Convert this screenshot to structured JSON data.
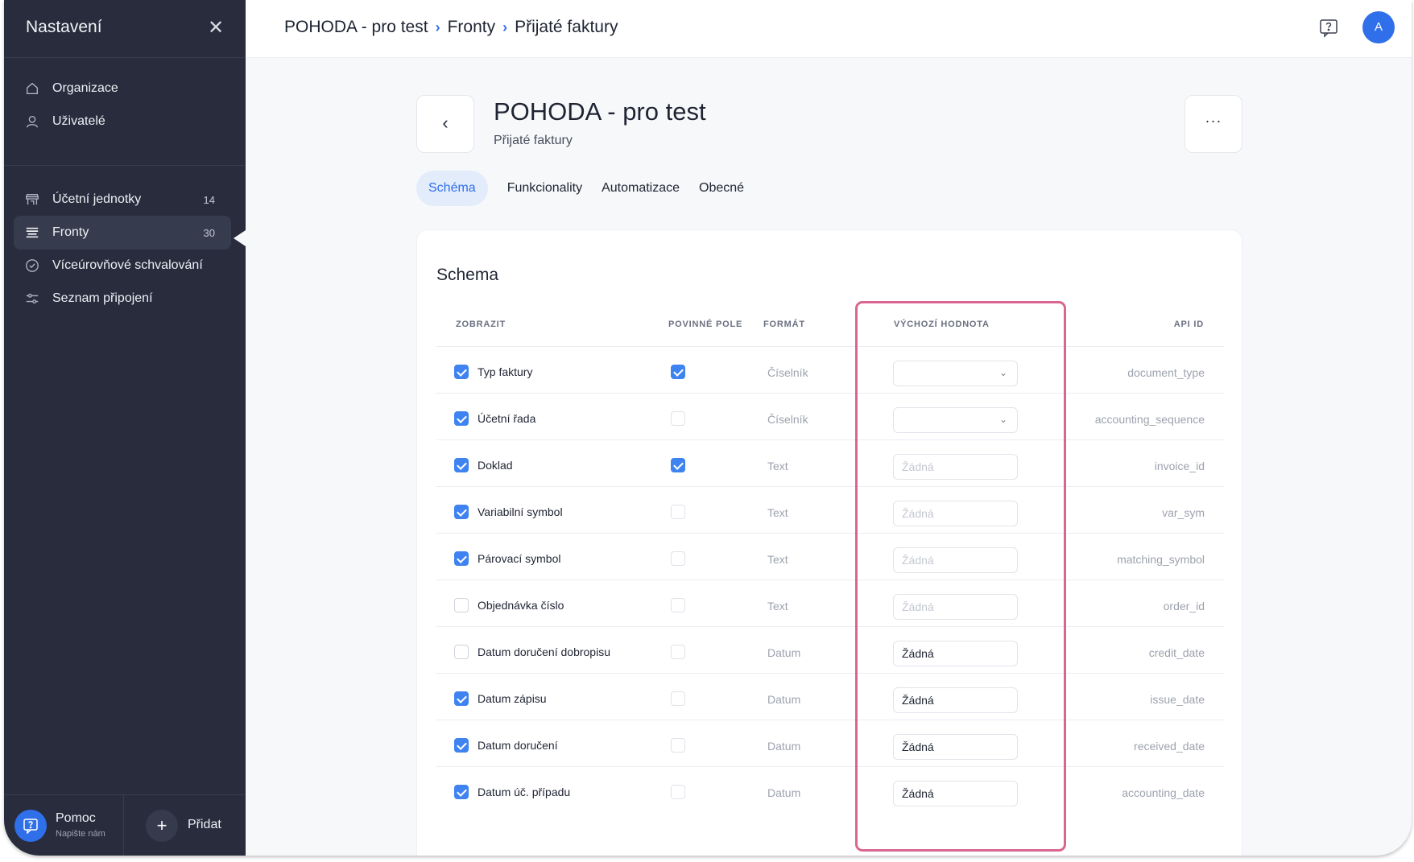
{
  "sidebar": {
    "title": "Nastavení",
    "close_icon": "close-icon",
    "group1": [
      {
        "label": "Organizace",
        "icon": "home-icon"
      },
      {
        "label": "Uživatelé",
        "icon": "user-icon"
      }
    ],
    "group2": [
      {
        "label": "Účetní jednotky",
        "icon": "store-icon",
        "count": "14"
      },
      {
        "label": "Fronty",
        "icon": "list-icon",
        "count": "30",
        "active": true
      },
      {
        "label": "Víceúrovňové schvalování",
        "icon": "check-circle-icon"
      },
      {
        "label": "Seznam připojení",
        "icon": "sliders-icon"
      }
    ],
    "help": {
      "title": "Pomoc",
      "subtitle": "Napište nám"
    },
    "add_label": "Přidat"
  },
  "topbar": {
    "breadcrumb": [
      "POHODA - pro test",
      "Fronty",
      "Přijaté faktury"
    ],
    "avatar_initial": "A"
  },
  "header": {
    "back_label": "‹",
    "title": "POHODA - pro test",
    "subtitle": "Přijaté faktury",
    "more_label": "···"
  },
  "tabs": [
    "Schéma",
    "Funkcionality",
    "Automatizace",
    "Obecné"
  ],
  "schema": {
    "title": "Schema",
    "columns": {
      "show": "ZOBRAZIT",
      "required": "POVINNÉ POLE",
      "format": "FORMÁT",
      "default": "VÝCHOZÍ HODNOTA",
      "api_id": "API ID"
    },
    "rows": [
      {
        "name": "Typ faktury",
        "shown": true,
        "required": true,
        "format": "Číselník",
        "default_type": "select",
        "default": "",
        "api_id": "document_type"
      },
      {
        "name": "Účetní řada",
        "shown": true,
        "required": false,
        "format": "Číselník",
        "default_type": "select",
        "default": "",
        "api_id": "accounting_sequence"
      },
      {
        "name": "Doklad",
        "shown": true,
        "required": true,
        "format": "Text",
        "default_type": "placeholder",
        "default": "Žádná",
        "api_id": "invoice_id"
      },
      {
        "name": "Variabilní symbol",
        "shown": true,
        "required": false,
        "format": "Text",
        "default_type": "placeholder",
        "default": "Žádná",
        "api_id": "var_sym"
      },
      {
        "name": "Párovací symbol",
        "shown": true,
        "required": false,
        "format": "Text",
        "default_type": "placeholder",
        "default": "Žádná",
        "api_id": "matching_symbol"
      },
      {
        "name": "Objednávka číslo",
        "shown": false,
        "required": false,
        "format": "Text",
        "default_type": "placeholder",
        "default": "Žádná",
        "api_id": "order_id"
      },
      {
        "name": "Datum doručení dobropisu",
        "shown": false,
        "required": false,
        "format": "Datum",
        "default_type": "value",
        "default": "Žádná",
        "api_id": "credit_date"
      },
      {
        "name": "Datum zápisu",
        "shown": true,
        "required": false,
        "format": "Datum",
        "default_type": "value",
        "default": "Žádná",
        "api_id": "issue_date"
      },
      {
        "name": "Datum doručení",
        "shown": true,
        "required": false,
        "format": "Datum",
        "default_type": "value",
        "default": "Žádná",
        "api_id": "received_date"
      },
      {
        "name": "Datum úč. případu",
        "shown": true,
        "required": false,
        "format": "Datum",
        "default_type": "value",
        "default": "Žádná",
        "api_id": "accounting_date"
      }
    ]
  },
  "colors": {
    "accent": "#2f6fea",
    "sidebar_bg": "#282c3d",
    "highlight": "#d86691"
  }
}
